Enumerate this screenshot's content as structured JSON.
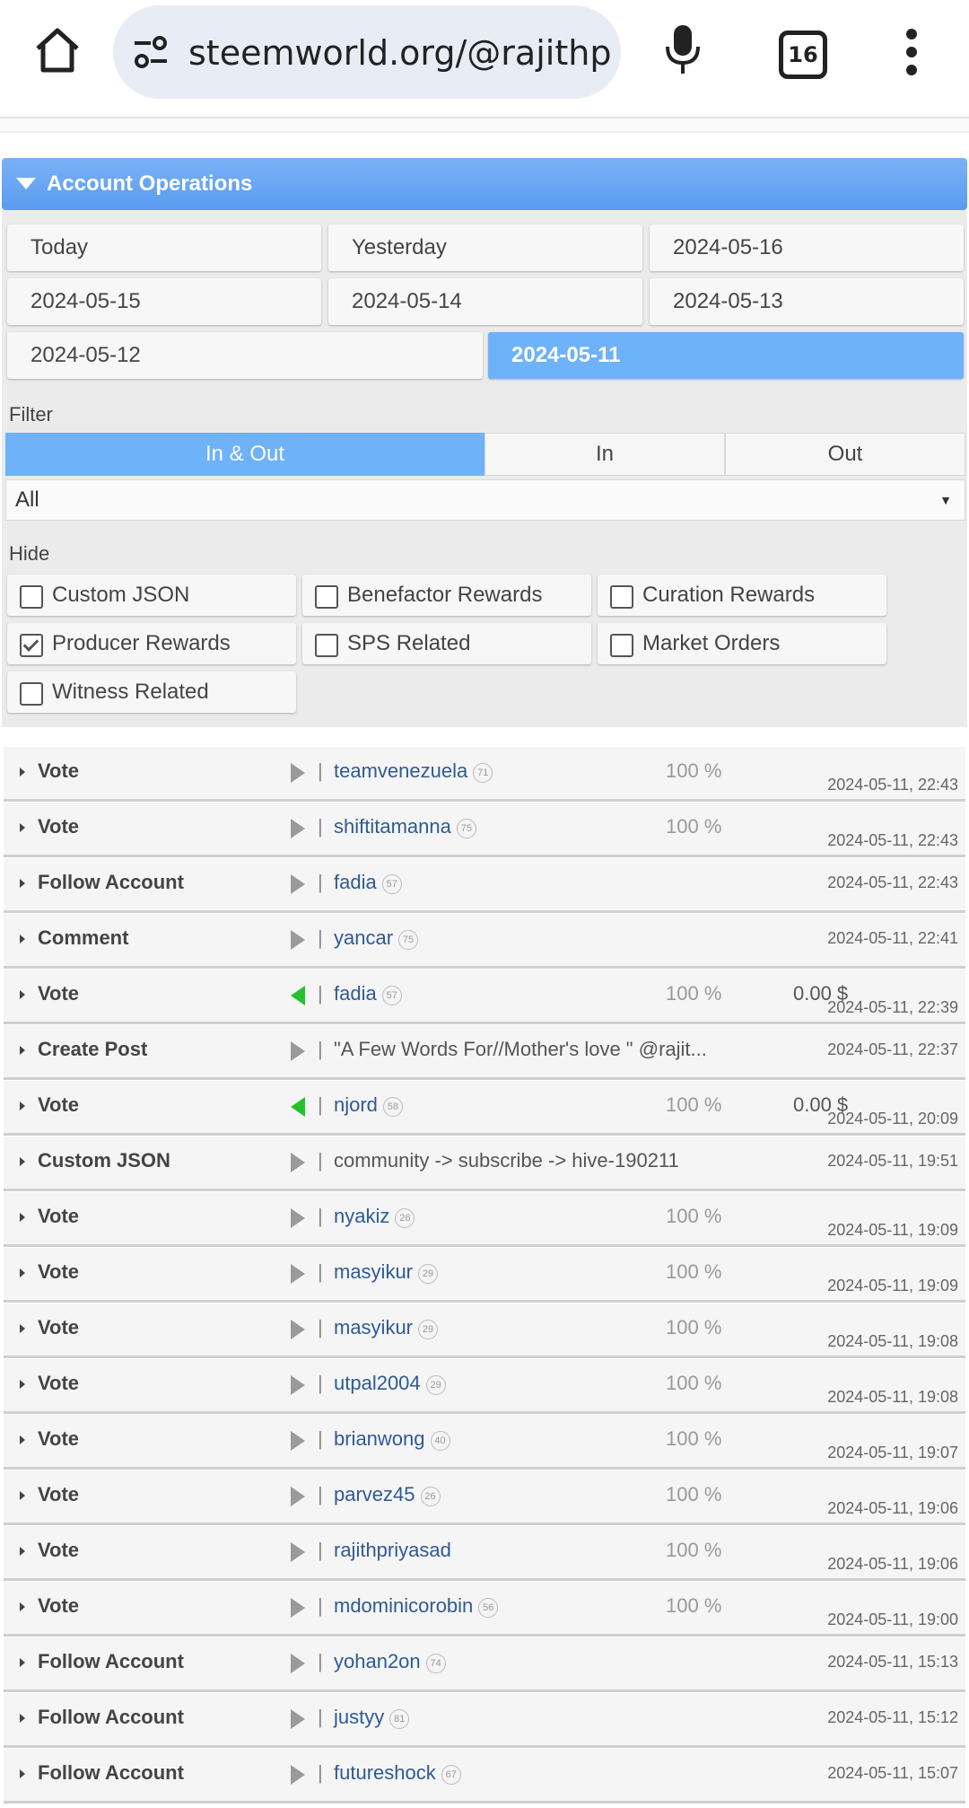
{
  "browser": {
    "url": "steemworld.org/@rajithpriy",
    "tab_count": "16"
  },
  "section": {
    "title": "Account Operations"
  },
  "dates": [
    "Today",
    "Yesterday",
    "2024-05-16",
    "2024-05-15",
    "2024-05-14",
    "2024-05-13",
    "2024-05-12",
    "2024-05-11"
  ],
  "selected_date": "2024-05-11",
  "filter": {
    "label": "Filter",
    "direction_options": [
      "In & Out",
      "In",
      "Out"
    ],
    "selected_direction": "In & Out",
    "type_select": "All"
  },
  "hide": {
    "label": "Hide",
    "options": [
      {
        "label": "Custom JSON",
        "checked": false
      },
      {
        "label": "Benefactor Rewards",
        "checked": false
      },
      {
        "label": "Curation Rewards",
        "checked": false
      },
      {
        "label": "Producer Rewards",
        "checked": true
      },
      {
        "label": "SPS Related",
        "checked": false
      },
      {
        "label": "Market Orders",
        "checked": false
      },
      {
        "label": "Witness Related",
        "checked": false
      }
    ]
  },
  "operations": [
    {
      "type": "Vote",
      "direction": "out",
      "account": "teamvenezuela",
      "rep": "71",
      "pct": "100 %",
      "amount": "",
      "date": "2024-05-11, 22:43"
    },
    {
      "type": "Vote",
      "direction": "out",
      "account": "shiftitamanna",
      "rep": "75",
      "pct": "100 %",
      "amount": "",
      "date": "2024-05-11, 22:43"
    },
    {
      "type": "Follow Account",
      "direction": "out",
      "account": "fadia",
      "rep": "57",
      "pct": "",
      "amount": "",
      "date": "2024-05-11, 22:43"
    },
    {
      "type": "Comment",
      "direction": "out",
      "account": "yancar",
      "rep": "75",
      "pct": "",
      "amount": "",
      "date": "2024-05-11, 22:41"
    },
    {
      "type": "Vote",
      "direction": "in",
      "account": "fadia",
      "rep": "57",
      "pct": "100 %",
      "amount": "0.00 $",
      "date": "2024-05-11, 22:39"
    },
    {
      "type": "Create Post",
      "direction": "out",
      "account": "\"A Few Words For//Mother's love \" @rajit...",
      "rep": "",
      "pct": "",
      "amount": "",
      "date": "2024-05-11, 22:37"
    },
    {
      "type": "Vote",
      "direction": "in",
      "account": "njord",
      "rep": "58",
      "pct": "100 %",
      "amount": "0.00 $",
      "date": "2024-05-11, 20:09"
    },
    {
      "type": "Custom JSON",
      "direction": "out",
      "account": "community -> subscribe -> hive-190211",
      "rep": "",
      "pct": "",
      "amount": "",
      "date": "2024-05-11, 19:51"
    },
    {
      "type": "Vote",
      "direction": "out",
      "account": "nyakiz",
      "rep": "26",
      "pct": "100 %",
      "amount": "",
      "date": "2024-05-11, 19:09"
    },
    {
      "type": "Vote",
      "direction": "out",
      "account": "masyikur",
      "rep": "29",
      "pct": "100 %",
      "amount": "",
      "date": "2024-05-11, 19:09"
    },
    {
      "type": "Vote",
      "direction": "out",
      "account": "masyikur",
      "rep": "29",
      "pct": "100 %",
      "amount": "",
      "date": "2024-05-11, 19:08"
    },
    {
      "type": "Vote",
      "direction": "out",
      "account": "utpal2004",
      "rep": "29",
      "pct": "100 %",
      "amount": "",
      "date": "2024-05-11, 19:08"
    },
    {
      "type": "Vote",
      "direction": "out",
      "account": "brianwong",
      "rep": "40",
      "pct": "100 %",
      "amount": "",
      "date": "2024-05-11, 19:07"
    },
    {
      "type": "Vote",
      "direction": "out",
      "account": "parvez45",
      "rep": "26",
      "pct": "100 %",
      "amount": "",
      "date": "2024-05-11, 19:06"
    },
    {
      "type": "Vote",
      "direction": "out",
      "account": "rajithpriyasad",
      "rep": "",
      "pct": "100 %",
      "amount": "",
      "date": "2024-05-11, 19:06"
    },
    {
      "type": "Vote",
      "direction": "out",
      "account": "mdominicorobin",
      "rep": "56",
      "pct": "100 %",
      "amount": "",
      "date": "2024-05-11, 19:00"
    },
    {
      "type": "Follow Account",
      "direction": "out",
      "account": "yohan2on",
      "rep": "74",
      "pct": "",
      "amount": "",
      "date": "2024-05-11, 15:13"
    },
    {
      "type": "Follow Account",
      "direction": "out",
      "account": "justyy",
      "rep": "81",
      "pct": "",
      "amount": "",
      "date": "2024-05-11, 15:12"
    },
    {
      "type": "Follow Account",
      "direction": "out",
      "account": "futureshock",
      "rep": "67",
      "pct": "",
      "amount": "",
      "date": "2024-05-11, 15:07"
    }
  ],
  "colors": {
    "accent": "#6eb2f9",
    "link": "#2e5a94",
    "incoming": "#27c12f"
  }
}
